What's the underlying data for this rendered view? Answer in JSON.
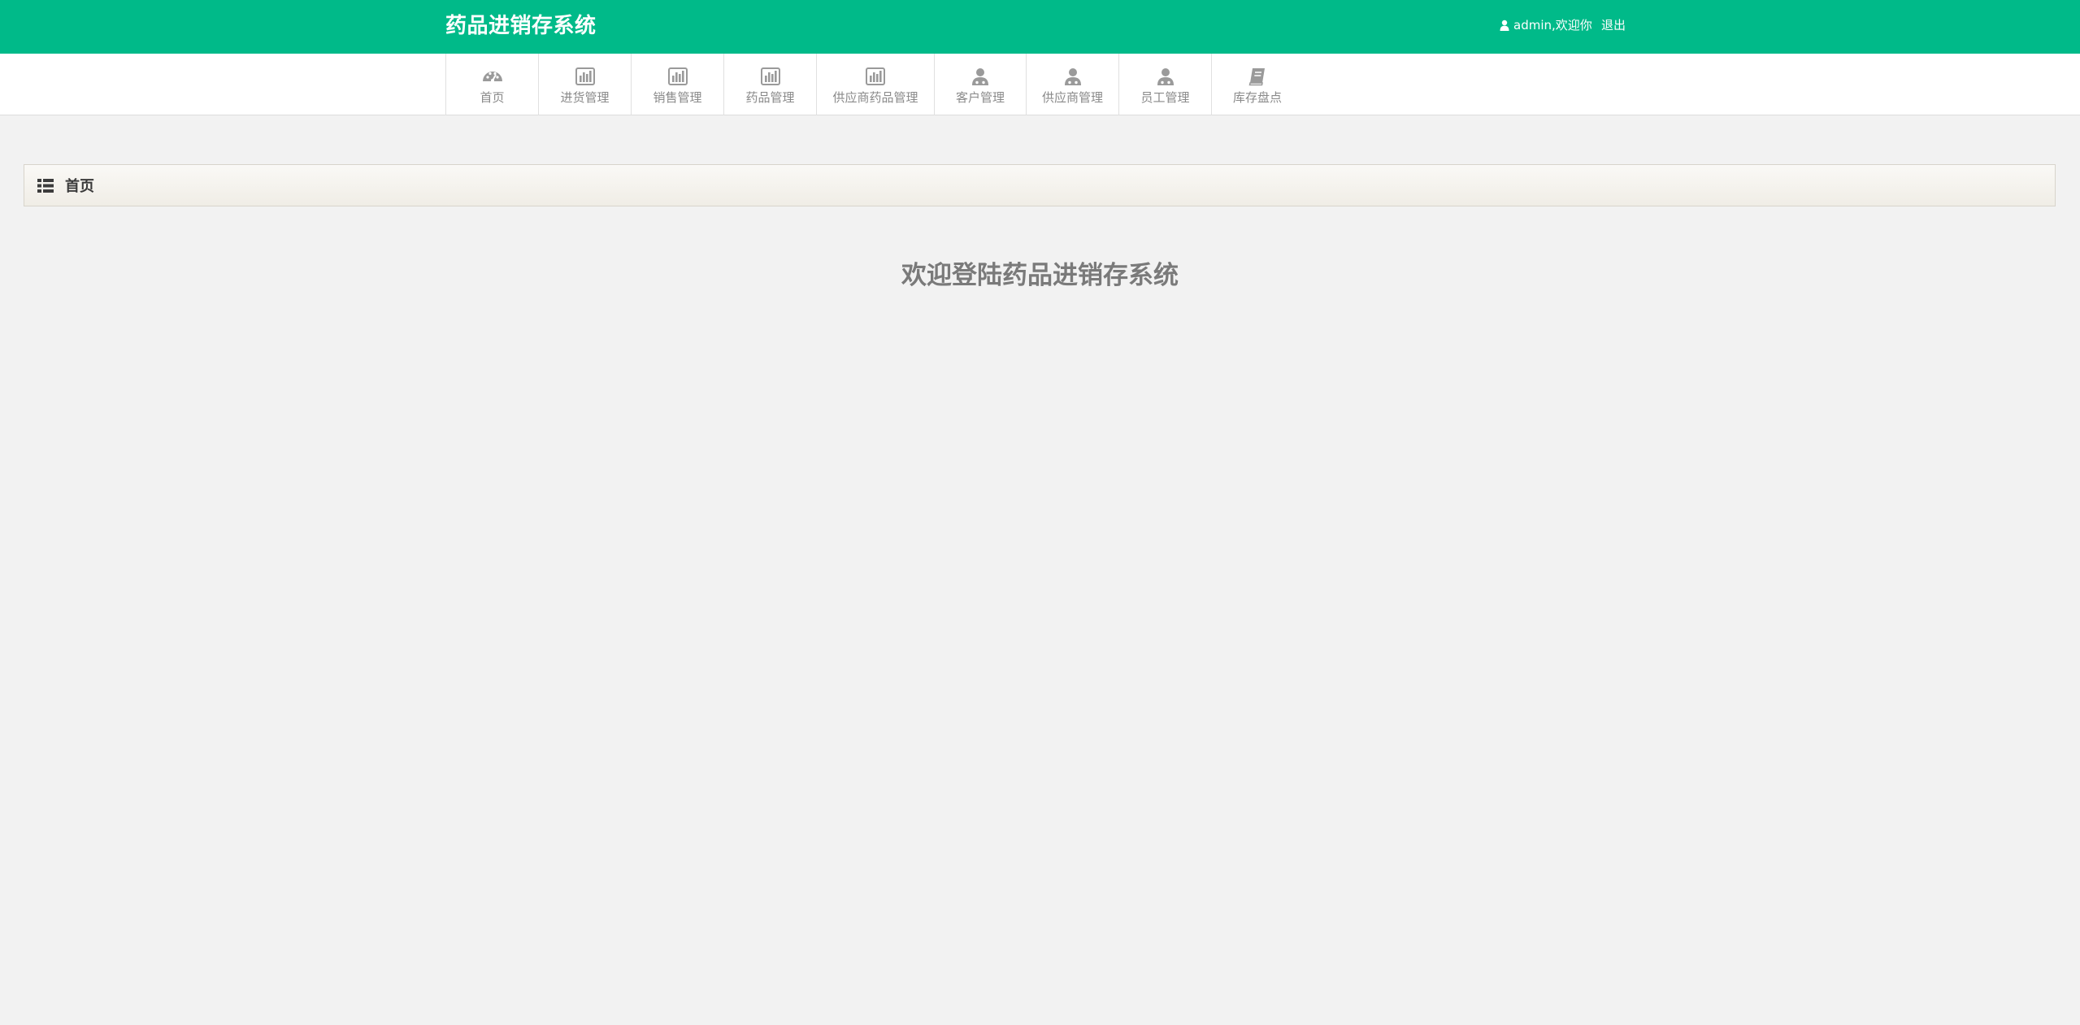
{
  "header": {
    "brand": "药品进销存系统",
    "user_text": "admin,欢迎你",
    "logout_label": "退出"
  },
  "nav": {
    "items": [
      {
        "label": "首页",
        "icon": "dashboard-icon"
      },
      {
        "label": "进货管理",
        "icon": "bar-chart-icon"
      },
      {
        "label": "销售管理",
        "icon": "bar-chart-icon"
      },
      {
        "label": "药品管理",
        "icon": "bar-chart-icon"
      },
      {
        "label": "供应商药品管理",
        "icon": "bar-chart-icon"
      },
      {
        "label": "客户管理",
        "icon": "user-icon"
      },
      {
        "label": "供应商管理",
        "icon": "user-icon"
      },
      {
        "label": "员工管理",
        "icon": "user-icon"
      },
      {
        "label": "库存盘点",
        "icon": "book-icon"
      }
    ]
  },
  "panel": {
    "title": "首页"
  },
  "main": {
    "welcome": "欢迎登陆药品进销存系统"
  },
  "colors": {
    "header_bg": "#00ba89",
    "nav_text": "#8a8a8a",
    "welcome_text": "#7a7a7a"
  }
}
